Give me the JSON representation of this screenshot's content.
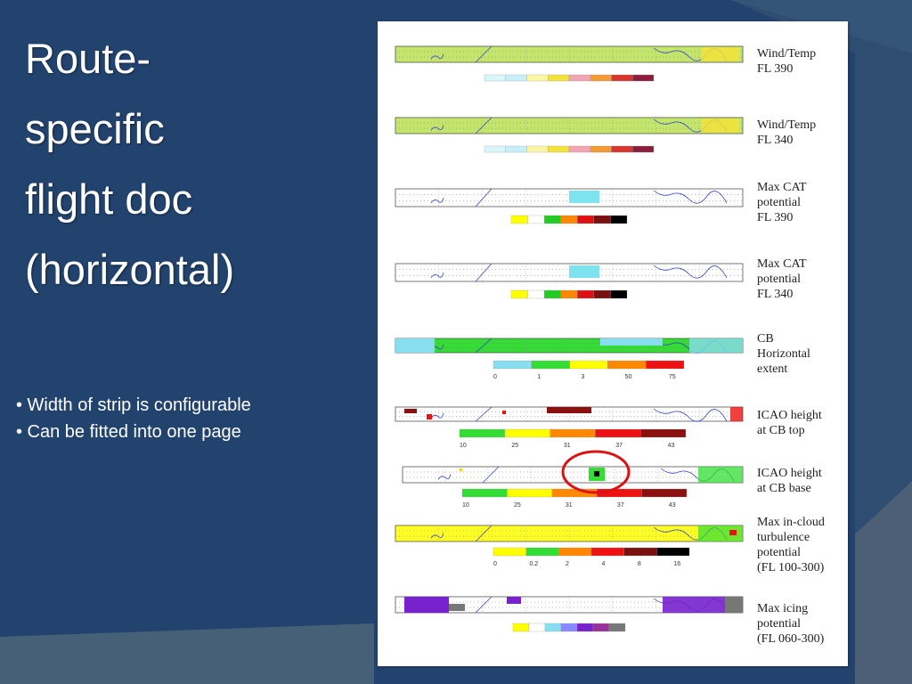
{
  "slide": {
    "title_lines": [
      "Route-",
      "specific",
      "flight doc",
      "(horizontal)"
    ],
    "bullets": [
      "• Width of strip is configurable",
      "• Can be fitted into one page"
    ]
  },
  "document": {
    "panels": [
      {
        "id": "wind-temp-fl390",
        "label_lines": [
          "Wind/Temp",
          "FL 390"
        ],
        "strip_fill": "#c3e66a",
        "scale_labels": [],
        "scale_colors": [
          "#d9f6fb",
          "#c8eef8",
          "#fbf6a4",
          "#f3e23a",
          "#f1a4b4",
          "#f29a33",
          "#d9352f",
          "#8b1d3f"
        ]
      },
      {
        "id": "wind-temp-fl340",
        "label_lines": [
          "Wind/Temp",
          "FL 340"
        ],
        "strip_fill": "#c3e66a",
        "scale_labels": [],
        "scale_colors": [
          "#d9f6fb",
          "#c8eef8",
          "#fbf6a4",
          "#f3e23a",
          "#f1a4b4",
          "#f29a33",
          "#d9352f",
          "#8b1d3f"
        ]
      },
      {
        "id": "max-cat-fl390",
        "label_lines": [
          "Max CAT",
          "potential",
          "FL 390"
        ],
        "strip_fill": "#ffffff",
        "scale_labels": [],
        "scale_colors": [
          "#ffff00",
          "#ffffff",
          "#22cc22",
          "#ff8800",
          "#dd1111",
          "#7a1010",
          "#000000"
        ]
      },
      {
        "id": "max-cat-fl340",
        "label_lines": [
          "Max CAT",
          "potential",
          "FL 340"
        ],
        "strip_fill": "#ffffff",
        "scale_labels": [],
        "scale_colors": [
          "#ffff00",
          "#ffffff",
          "#22cc22",
          "#ff8800",
          "#dd1111",
          "#7a1010",
          "#000000"
        ]
      },
      {
        "id": "cb-horizontal-extent",
        "label_lines": [
          "CB",
          "Horizontal",
          "extent"
        ],
        "strip_fill": "#33dd33",
        "scale_labels": [
          "0",
          "1",
          "3",
          "50",
          "75"
        ],
        "scale_colors": [
          "#88ddee",
          "#33dd33",
          "#ffff00",
          "#ff8800",
          "#ee1111"
        ]
      },
      {
        "id": "icao-height-cb-top",
        "label_lines": [
          "ICAO height",
          "at CB top"
        ],
        "strip_fill": "#ffffff",
        "scale_labels": [
          "10",
          "25",
          "31",
          "37",
          "43"
        ],
        "scale_colors": [
          "#33dd33",
          "#ffff00",
          "#ff8800",
          "#ee1111",
          "#8b1010"
        ]
      },
      {
        "id": "icao-height-cb-base",
        "label_lines": [
          "ICAO height",
          "at CB base"
        ],
        "strip_fill": "#ffffff",
        "scale_labels": [
          "10",
          "25",
          "31",
          "37",
          "43"
        ],
        "scale_colors": [
          "#33dd33",
          "#ffff00",
          "#ff8800",
          "#ee1111",
          "#8b1010"
        ]
      },
      {
        "id": "max-in-cloud-turbulence",
        "label_lines": [
          "Max in-cloud",
          "turbulence",
          "potential",
          "(FL 100-300)"
        ],
        "strip_fill": "#ffff22",
        "scale_labels": [
          "0",
          "0.2",
          "2",
          "4",
          "8",
          "16"
        ],
        "scale_colors": [
          "#ffff00",
          "#33dd33",
          "#ff8800",
          "#ee1111",
          "#7a1010",
          "#000000"
        ]
      },
      {
        "id": "max-icing-potential",
        "label_lines": [
          "Max icing",
          "potential",
          "(FL 060-300)"
        ],
        "strip_fill": "#ffffff",
        "scale_labels": [],
        "scale_colors": [
          "#ffff00",
          "#ffffff",
          "#88ddee",
          "#8888ff",
          "#7722cc",
          "#993399",
          "#777777"
        ]
      }
    ],
    "highlight_color": "#dd1111"
  }
}
